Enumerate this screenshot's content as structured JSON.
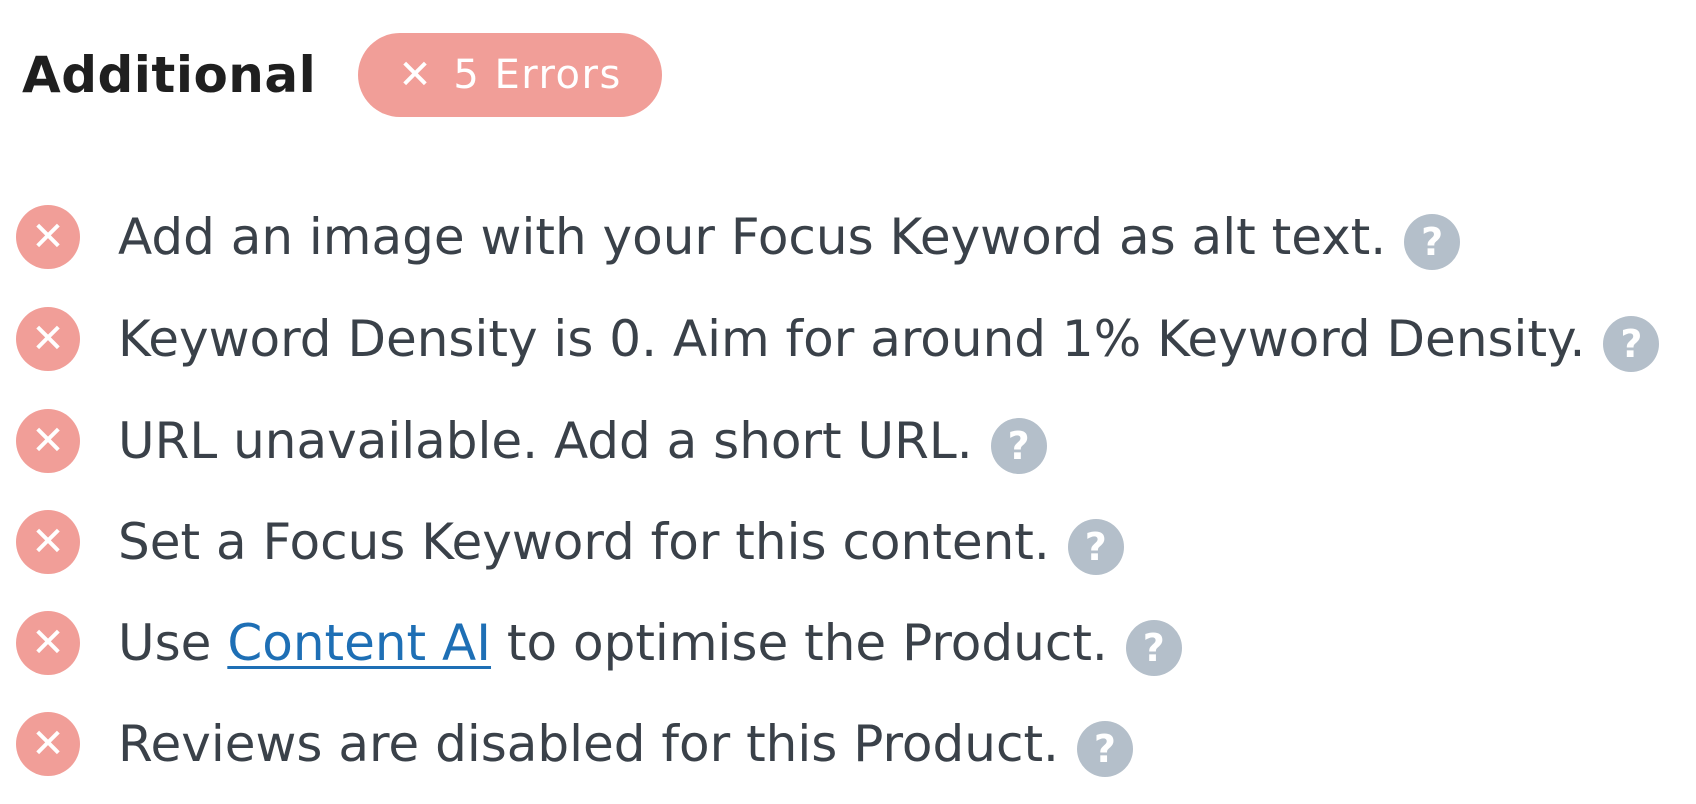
{
  "header": {
    "title": "Additional",
    "badge": {
      "icon": "close-icon",
      "glyph": "✕",
      "label": "5 Errors",
      "color": "#f19e98"
    }
  },
  "items": [
    {
      "status": "error",
      "text_before": "Add an image with your Focus Keyword as alt text.",
      "link": "",
      "text_after": ""
    },
    {
      "status": "error",
      "text_before": "Keyword Density is 0. Aim for around 1% Keyword Density.",
      "link": "",
      "text_after": ""
    },
    {
      "status": "error",
      "text_before": "URL unavailable. Add a short URL.",
      "link": "",
      "text_after": ""
    },
    {
      "status": "error",
      "text_before": "Set a Focus Keyword for this content.",
      "link": "",
      "text_after": ""
    },
    {
      "status": "error",
      "text_before": "Use ",
      "link": "Content AI",
      "text_after": " to optimise the Product."
    },
    {
      "status": "error",
      "text_before": "Reviews are disabled for this Product.",
      "link": "",
      "text_after": ""
    }
  ],
  "icons": {
    "error": "✕",
    "help": "?"
  },
  "colors": {
    "error": "#f19e98",
    "help": "#b4bfca",
    "link": "#1e6fb5",
    "text": "#3a4149"
  }
}
